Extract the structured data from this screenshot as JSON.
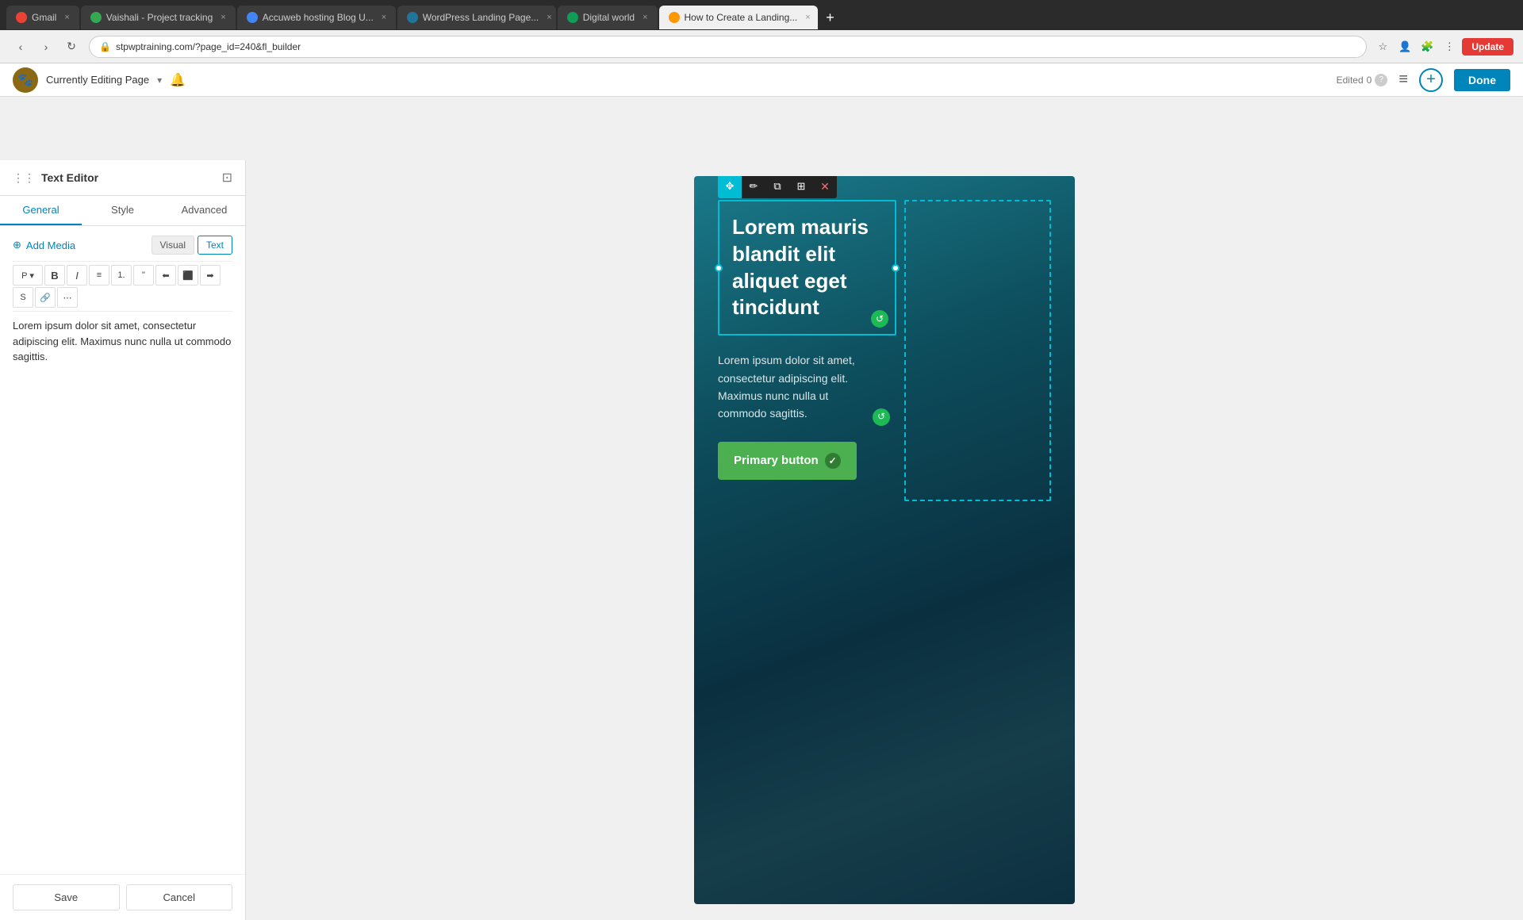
{
  "browser": {
    "tabs": [
      {
        "id": "gmail",
        "label": "Gmail",
        "active": false,
        "icon_color": "#EA4335"
      },
      {
        "id": "vaishali",
        "label": "Vaishali - Project tracking",
        "active": false,
        "icon_color": "#34A853"
      },
      {
        "id": "accuweb",
        "label": "Accuweb hosting Blog U...",
        "active": false,
        "icon_color": "#4285F4"
      },
      {
        "id": "wordpress",
        "label": "WordPress Landing Page...",
        "active": false,
        "icon_color": "#21759B"
      },
      {
        "id": "digital",
        "label": "Digital world",
        "active": false,
        "icon_color": "#0f9d58"
      },
      {
        "id": "howto",
        "label": "How to Create a Landing...",
        "active": true,
        "icon_color": "#ff9800"
      }
    ],
    "url": "stpwptraining.com/?page_id=240&fl_builder",
    "update_label": "Update"
  },
  "wp_topbar": {
    "site_logo": "🐾",
    "editing_page_label": "Currently Editing Page",
    "dropdown_symbol": "▾",
    "bell_symbol": "🔔",
    "edited_label": "Edited",
    "edited_count": "0",
    "help_symbol": "?",
    "list_icon": "≡",
    "add_icon": "+",
    "done_label": "Done"
  },
  "sidebar": {
    "title": "Text Editor",
    "minimize_icon": "⊡",
    "tabs": [
      {
        "label": "General",
        "active": true
      },
      {
        "label": "Style",
        "active": false
      },
      {
        "label": "Advanced",
        "active": false
      }
    ],
    "add_media_label": "Add Media",
    "add_media_icon": "⊕",
    "view_visual": "Visual",
    "view_text": "Text",
    "toolbar": {
      "paragraph_btn": "P ▾",
      "bold": "B",
      "italic": "I",
      "ul": "≡",
      "ol": "1.",
      "blockquote": "❝",
      "align_left": "⬅",
      "align_center": "⬛",
      "align_right": "➡",
      "strikethrough": "S",
      "link": "🔗",
      "more": "⋯"
    },
    "editor_content": "Lorem ipsum dolor sit amet, consectetur adipiscing elit. Maximus nunc nulla ut commodo sagittis.",
    "save_label": "Save",
    "cancel_label": "Cancel"
  },
  "canvas": {
    "heading": "Lorem mauris blandit elit aliquet eget tincidunt",
    "body_text": "Lorem ipsum dolor sit amet, consectetur adipiscing elit. Maximus nunc nulla ut commodo sagittis.",
    "primary_button_label": "Primary button",
    "check_icon": "✓",
    "element_tools": [
      "✥",
      "✏",
      "⧉",
      "⊞",
      "✕"
    ],
    "regen_icon": "↺"
  }
}
